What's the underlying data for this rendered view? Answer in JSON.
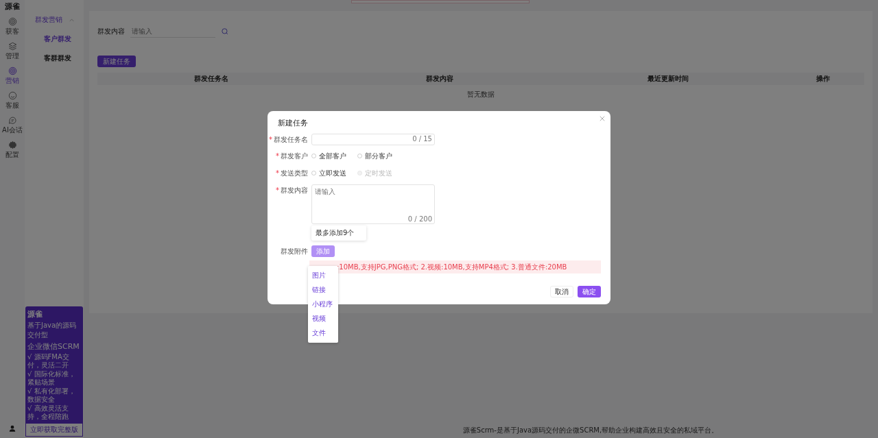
{
  "rail": {
    "logo": "源雀",
    "items": [
      {
        "label": "获客",
        "selected": false
      },
      {
        "label": "管理",
        "selected": false
      },
      {
        "label": "营销",
        "selected": true
      },
      {
        "label": "客服",
        "selected": false
      },
      {
        "label": "AI会话",
        "selected": false
      },
      {
        "label": "配置",
        "selected": false
      }
    ]
  },
  "submenu": {
    "group": {
      "label": "群发营销",
      "expanded": true
    },
    "items": [
      {
        "label": "客户群发",
        "selected": true
      },
      {
        "label": "客群群发",
        "selected": false
      }
    ]
  },
  "promo": {
    "brand": "源雀",
    "line1": "基于Java的源码交付型",
    "line2": "企业微信SCRM",
    "bullets": [
      "√ 源码FMA交付，灵活二开",
      "√ 国际化标准，紧贴场景",
      "√ 私有化部署，数据安全",
      "√ 高效灵活支持，全程陪跑"
    ],
    "button": "立即获取完整版"
  },
  "search": {
    "label": "群发内容",
    "placeholder": "请输入"
  },
  "new_button": "新建任务",
  "table": {
    "columns": [
      "群发任务名",
      "群发内容",
      "最近更新时间",
      "操作"
    ],
    "empty": "暂无数据"
  },
  "footer": "源雀Scrm-是基于Java源码交付的企微SCRM,帮助企业构建高效且安全的私域平台。",
  "dialog": {
    "title": "新建任务",
    "fields": [
      {
        "kind": "input",
        "label": "群发任务名",
        "mark": "*",
        "counter": "0 / 15"
      },
      {
        "kind": "radio",
        "label": "群发客户",
        "mark": "*",
        "options": [
          {
            "label": "全部客户",
            "selected": false,
            "disabled": false
          },
          {
            "label": "部分客户",
            "selected": false,
            "disabled": false
          }
        ]
      },
      {
        "kind": "radio",
        "label": "发送类型",
        "mark": "*",
        "options": [
          {
            "label": "立即发送",
            "selected": false,
            "disabled": false
          },
          {
            "label": "定时发送",
            "selected": false,
            "disabled": true
          }
        ]
      },
      {
        "kind": "textarea",
        "label": "群发内容",
        "mark": "*",
        "placeholder": "请输入",
        "counter": "0 / 200"
      },
      {
        "kind": "attach",
        "label": "群发附件",
        "button": "添加",
        "tooltip": "最多添加9个",
        "alert": ":10MB,支持JPG,PNG格式; 2.视频:10MB,支持MP4格式; 3.普通文件:20MB"
      }
    ],
    "menu": [
      "图片",
      "链接",
      "小程序",
      "视频",
      "文件"
    ],
    "cancel": "取消",
    "ok": "确定"
  }
}
